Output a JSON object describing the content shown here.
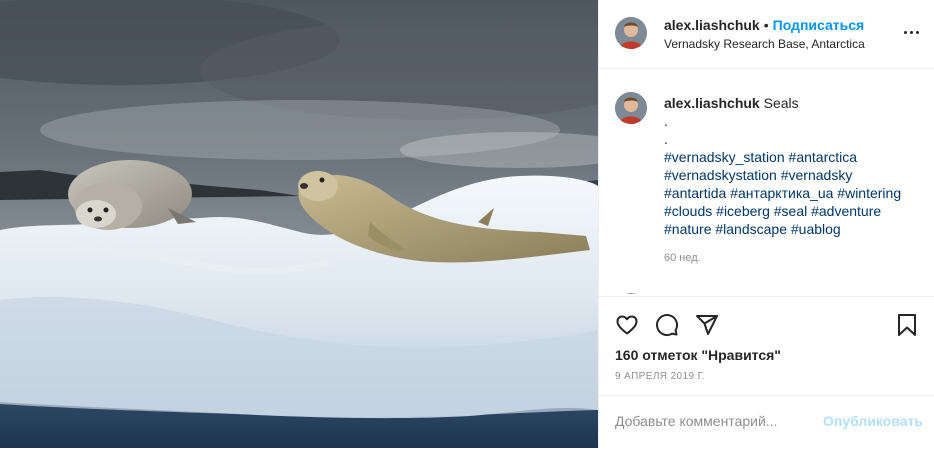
{
  "post": {
    "username": "alex.liashchuk",
    "dot": "•",
    "follow_label": "Подписаться",
    "location": "Vernadsky Research Base, Antarctica",
    "more_icon": "more-horizontal-icon",
    "photo_subject": "seals-on-iceberg-photo"
  },
  "caption": {
    "username": "alex.liashchuk",
    "text": "Seals",
    "lines": [
      ".",
      "."
    ],
    "hashtags": [
      [
        "#vernadsky_station",
        "#antarctica"
      ],
      [
        "#vernadskystation",
        "#vernadsky"
      ],
      [
        "#antartida",
        "#антарктика_ua",
        "#wintering"
      ],
      [
        "#clouds",
        "#iceberg",
        "#seal",
        "#adventure"
      ],
      [
        "#nature",
        "#landscape",
        "#uablog"
      ]
    ],
    "time_ago": "60 нед."
  },
  "actions": {
    "icons": [
      "heart-icon",
      "comment-icon",
      "share-icon",
      "bookmark-icon"
    ],
    "likes": "160 отметок \"Нравится\"",
    "date": "9 АПРЕЛЯ 2019 Г."
  },
  "comment_box": {
    "placeholder": "Добавьте комментарий...",
    "post_label": "Опубликовать"
  },
  "colors": {
    "accent": "#0095f6",
    "hashtag": "#00376b",
    "muted": "#8e8e8e",
    "post_disabled": "#b2dffc"
  }
}
